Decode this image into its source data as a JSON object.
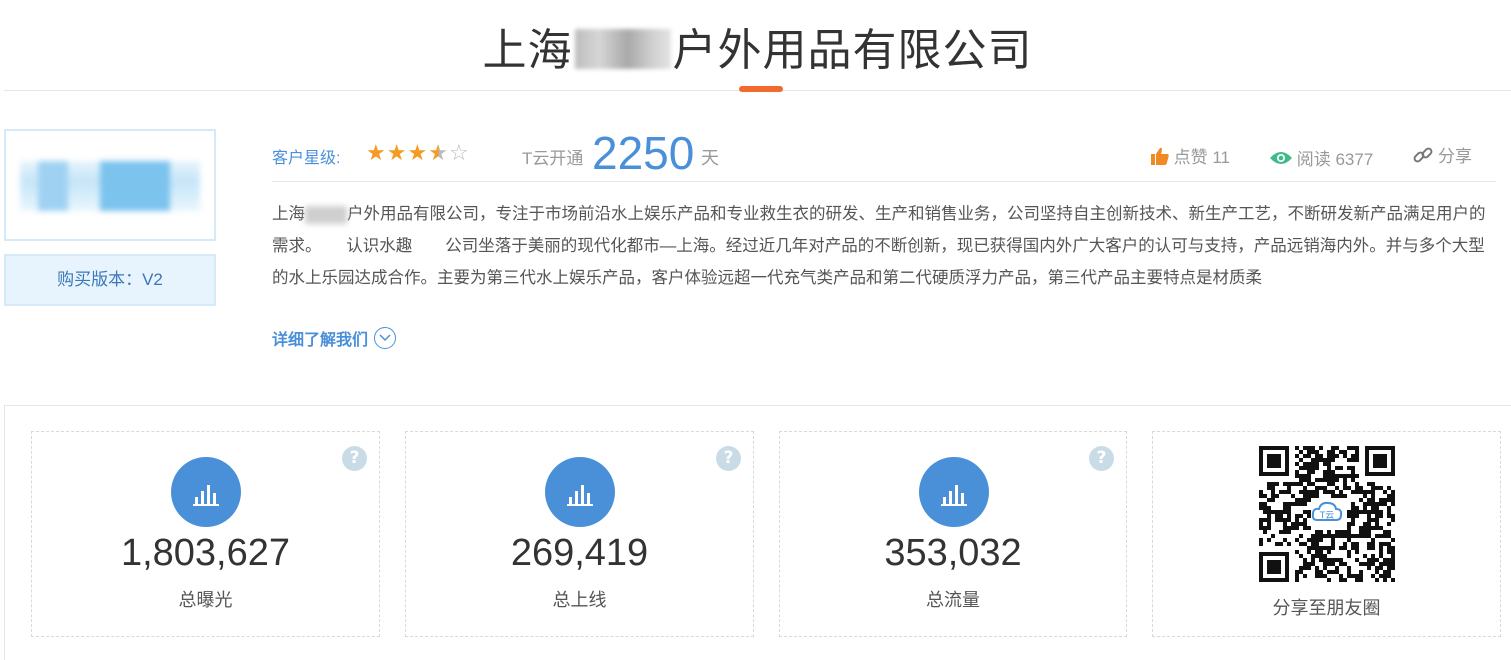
{
  "header": {
    "title_prefix": "上海",
    "title_suffix": "户外用品有限公司"
  },
  "sidebar": {
    "version_label": "购买版本：V2"
  },
  "info": {
    "rating_label": "客户星级:",
    "rating_value": 3.5,
    "rating_max": 5,
    "tyun_label": "T云开通",
    "tyun_days": "2250",
    "tyun_unit": "天",
    "like_label": "点赞 11",
    "read_label": "阅读 6377",
    "share_label": "分享"
  },
  "description": {
    "part1": "上海",
    "part2": "户外用品有限公司，专注于市场前沿水上娱乐产品和专业救生衣的研发、生产和销售业务，公司坚持自主创新技术、新生产工艺，不断研发新产品满足用户的需求。　　认识水趣　　公司坐落于美丽的现代化都市—上海。经过近几年对产品的不断创新，现已获得国内外广大客户的认可与支持，产品远销海内外。并与多个大型的水上乐园达成合作。主要为第三代水上娱乐产品，客户体验远超一代充气类产品和第二代硬质浮力产品，第三代产品主要特点是材质柔",
    "more_label": "详细了解我们"
  },
  "stats": [
    {
      "value": "1,803,627",
      "label": "总曝光",
      "help": "?"
    },
    {
      "value": "269,419",
      "label": "总上线",
      "help": "?"
    },
    {
      "value": "353,032",
      "label": "总流量",
      "help": "?"
    }
  ],
  "qr": {
    "label": "分享至朋友圈",
    "center_text": "T云"
  },
  "colors": {
    "accent_orange": "#f26a2e",
    "primary_blue": "#4a90d9",
    "star_orange": "#f59a23",
    "like_orange": "#f08a24",
    "eye_green": "#3dbb8a"
  }
}
